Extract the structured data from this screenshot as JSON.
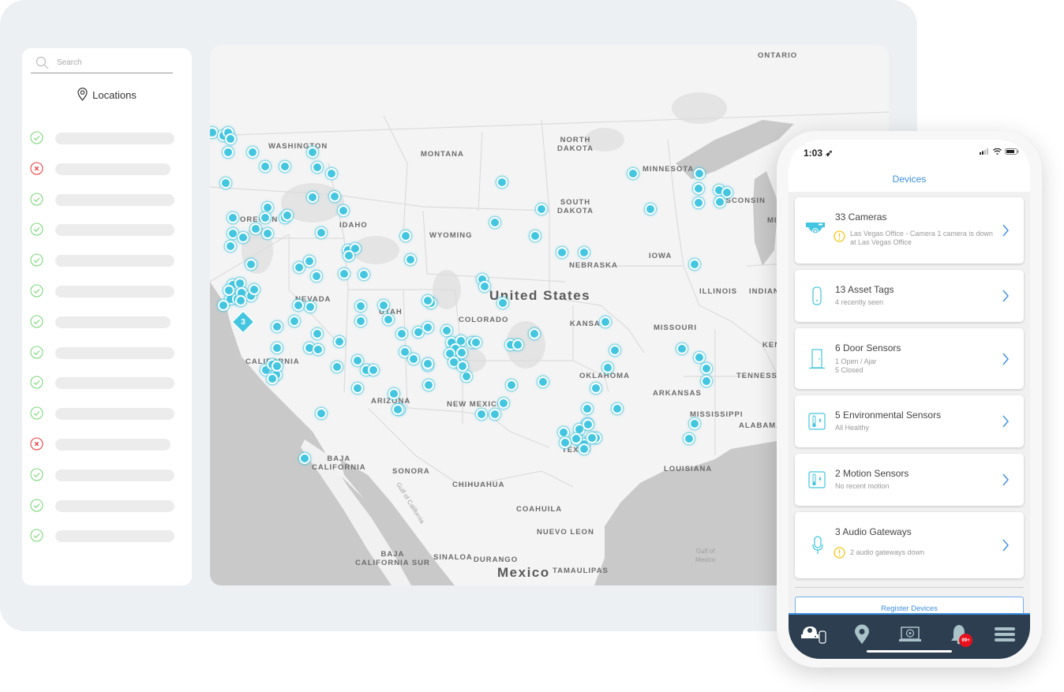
{
  "sidebar": {
    "search_placeholder": "Search",
    "title": "Locations",
    "locations": [
      {
        "status": "ok",
        "bar": 0.86
      },
      {
        "status": "error",
        "bar": 0.83
      },
      {
        "status": "ok",
        "bar": 0.86
      },
      {
        "status": "ok",
        "bar": 0.86
      },
      {
        "status": "ok",
        "bar": 0.86
      },
      {
        "status": "ok",
        "bar": 0.86
      },
      {
        "status": "ok",
        "bar": 0.83
      },
      {
        "status": "ok",
        "bar": 0.86
      },
      {
        "status": "ok",
        "bar": 0.86
      },
      {
        "status": "ok",
        "bar": 0.86
      },
      {
        "status": "error",
        "bar": 0.83
      },
      {
        "status": "ok",
        "bar": 0.86
      },
      {
        "status": "ok",
        "bar": 0.86
      },
      {
        "status": "ok",
        "bar": 0.86
      }
    ]
  },
  "map": {
    "country_labels": [
      "United States",
      "Mexico"
    ],
    "labels": [
      {
        "text": "ONTARIO",
        "kind": "region"
      },
      {
        "text": "WASHINGTON",
        "kind": "region"
      },
      {
        "text": "MONTANA",
        "kind": "region"
      },
      {
        "text": "NORTH\nDAKOTA",
        "kind": "region"
      },
      {
        "text": "MINNESOTA",
        "kind": "region"
      },
      {
        "text": "SOUTH\nDAKOTA",
        "kind": "region"
      },
      {
        "text": "WISCONSIN",
        "kind": "region"
      },
      {
        "text": "OREGON",
        "kind": "region"
      },
      {
        "text": "IDAHO",
        "kind": "region"
      },
      {
        "text": "WYOMING",
        "kind": "region"
      },
      {
        "text": "IOWA",
        "kind": "region"
      },
      {
        "text": "NEBRASKA",
        "kind": "region"
      },
      {
        "text": "NEVADA",
        "kind": "region"
      },
      {
        "text": "UTAH",
        "kind": "region"
      },
      {
        "text": "ILLINOIS",
        "kind": "region"
      },
      {
        "text": "INDIANA",
        "kind": "region"
      },
      {
        "text": "COLORADO",
        "kind": "region"
      },
      {
        "text": "KANSAS",
        "kind": "region"
      },
      {
        "text": "MISSOURI",
        "kind": "region"
      },
      {
        "text": "KENTUCKY",
        "kind": "region"
      },
      {
        "text": "CALIFORNIA",
        "kind": "region"
      },
      {
        "text": "OKLAHOMA",
        "kind": "region"
      },
      {
        "text": "TENNESSEE",
        "kind": "region"
      },
      {
        "text": "ARKANSAS",
        "kind": "region"
      },
      {
        "text": "ARIZONA",
        "kind": "region"
      },
      {
        "text": "NEW MEXICO",
        "kind": "region"
      },
      {
        "text": "MISSISSIPPI",
        "kind": "region"
      },
      {
        "text": "ALABAMA",
        "kind": "region"
      },
      {
        "text": "TEXAS",
        "kind": "region"
      },
      {
        "text": "LOUISIANA",
        "kind": "region"
      },
      {
        "text": "BAJA\nCALIFORNIA",
        "kind": "region"
      },
      {
        "text": "SONORA",
        "kind": "region"
      },
      {
        "text": "CHIHUAHUA",
        "kind": "region"
      },
      {
        "text": "COAHUILA",
        "kind": "region"
      },
      {
        "text": "NUEVO LEON",
        "kind": "region"
      },
      {
        "text": "BAJA\nCALIFORNIA SUR",
        "kind": "region"
      },
      {
        "text": "SINALOA",
        "kind": "region"
      },
      {
        "text": "DURANGO",
        "kind": "region"
      },
      {
        "text": "TAMAULIPAS",
        "kind": "region"
      },
      {
        "text": "MICHIGAN",
        "kind": "region"
      },
      {
        "text": "Gulf of California",
        "kind": "water"
      },
      {
        "text": "Gulf of\nMexico",
        "kind": "water"
      }
    ],
    "cluster_count": "3",
    "marker_color": "#44c6e0"
  },
  "phone": {
    "time": "1:03",
    "screen_title": "Devices",
    "devices": [
      {
        "title": "33 Cameras",
        "subtitle": "Las Vegas Office - Camera 1 camera is down at Las Vegas Office",
        "warning": true,
        "icon": "camera-icon"
      },
      {
        "title": "13 Asset Tags",
        "subtitle": "4 recently seen",
        "warning": false,
        "icon": "asset-tag-icon"
      },
      {
        "title": "6 Door Sensors",
        "subtitle_lines": [
          "1 Open / Ajar",
          "5 Closed"
        ],
        "warning": false,
        "icon": "door-icon"
      },
      {
        "title": "5 Environmental Sensors",
        "subtitle": "All Healthy",
        "warning": false,
        "icon": "thermometer-icon"
      },
      {
        "title": "2 Motion Sensors",
        "subtitle": "No recent motion",
        "warning": false,
        "icon": "thermometer-icon"
      },
      {
        "title": "3 Audio Gateways",
        "subtitle": "2 audio gateways down",
        "warning": true,
        "icon": "microphone-icon"
      }
    ],
    "register_label": "Register Devices",
    "tabs": [
      "devices-tab",
      "locations-tab",
      "video-tab",
      "alerts-tab",
      "menu-tab"
    ],
    "alert_badge": "99+",
    "colors": {
      "accent": "#3d8fe0",
      "tabbar": "#2d3e50",
      "warning": "#f5c518",
      "ok": "#7dd87d",
      "error": "#ee4444",
      "device_icon": "#44c6e0"
    }
  }
}
